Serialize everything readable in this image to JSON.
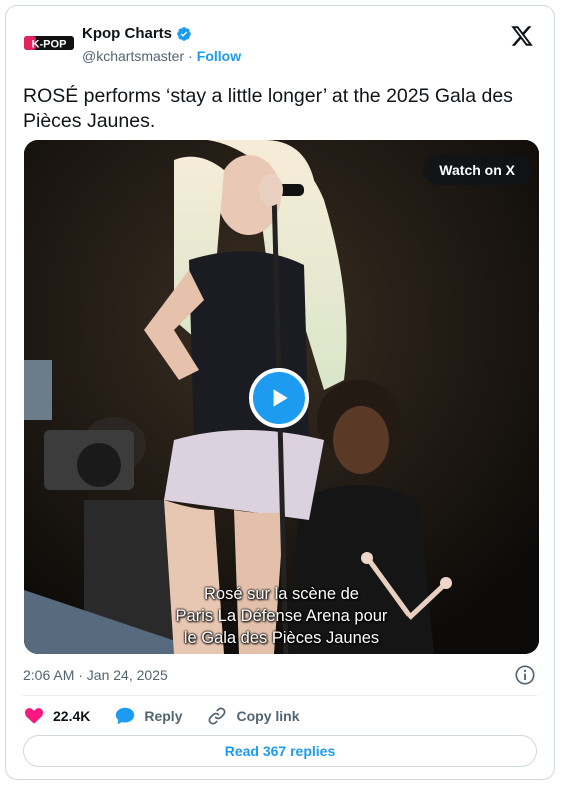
{
  "author": {
    "name": "Kpop Charts",
    "handle": "@kchartsmaster",
    "follow_label": "Follow",
    "logo_text": "K-POP"
  },
  "tweet": {
    "text": "ROSÉ performs ‘stay a little longer’ at the 2025 Gala des Pièces Jaunes."
  },
  "media": {
    "watch_label": "Watch on X",
    "subtitle_lines": [
      "Rosé sur la scène de",
      "Paris La Défense Arena pour",
      "le Gala des Pièces Jaunes"
    ]
  },
  "timestamp": "2:06 AM · Jan 24, 2025",
  "actions": {
    "like_count": "22.4K",
    "reply_label": "Reply",
    "copy_label": "Copy link"
  },
  "read_replies_label": "Read 367 replies",
  "colors": {
    "accent": "#1d9bf0",
    "like": "#f91880",
    "text": "#0f1419",
    "muted": "#536471"
  },
  "icons": [
    "verified-badge-icon",
    "x-logo-icon",
    "play-icon",
    "info-icon",
    "heart-icon",
    "reply-bubble-icon",
    "link-icon"
  ]
}
